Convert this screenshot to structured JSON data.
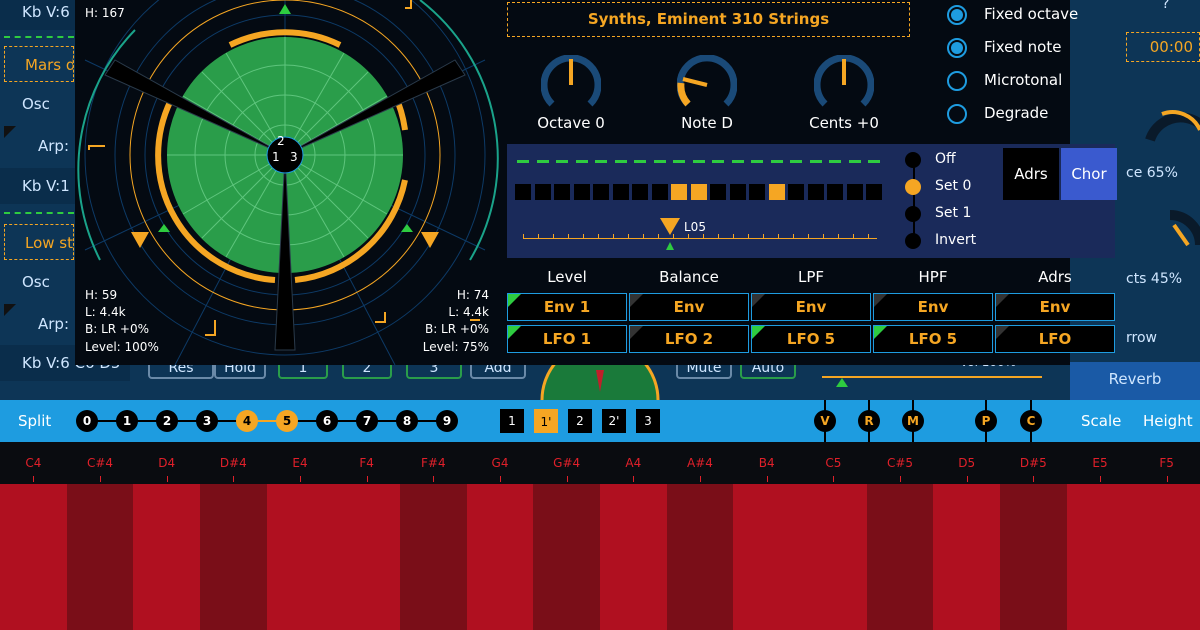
{
  "background": {
    "left_rows": [
      "Kb V:6 C",
      "Mars d",
      "Osc",
      "Arp:",
      "Kb V:1 C",
      "Low st",
      "Osc",
      "Arp:",
      "Kb V:6 C6 D5"
    ],
    "right_texts": {
      "help": "?",
      "clock": "00:00",
      "knob1": "ce 65%",
      "knob2": "cts 45%",
      "arrow": "rrow",
      "reverb": "Reverb"
    },
    "mid_buttons": [
      "Res",
      "Hold",
      "1",
      "2",
      "3",
      "Add",
      "Mute",
      "Auto"
    ],
    "mid_vol": "Vol 100%"
  },
  "radar": {
    "top_label": "H: 167",
    "center_numbers": [
      "2",
      "1",
      "3"
    ],
    "left_stats": [
      "H: 59",
      "L: 4.4k",
      "B: LR +0%",
      "Level: 100%"
    ],
    "right_stats": [
      "H: 74",
      "L: 4.4k",
      "B: LR +0%",
      "Level: 75%"
    ]
  },
  "preset": "Synths, Eminent 310 Strings",
  "knobs": [
    {
      "label": "Octave 0",
      "value": 0.5
    },
    {
      "label": "Note D",
      "value": 0.2
    },
    {
      "label": "Cents +0",
      "value": 0.5
    }
  ],
  "options": [
    {
      "label": "Fixed octave",
      "checked": true
    },
    {
      "label": "Fixed note",
      "checked": true
    },
    {
      "label": "Microtonal",
      "checked": false
    },
    {
      "label": "Degrade",
      "checked": false
    }
  ],
  "sequencer": {
    "steps_on": [
      8,
      9,
      13
    ],
    "step_count": 19,
    "marker": "L05",
    "modes": [
      {
        "label": "Off",
        "on": false
      },
      {
        "label": "Set 0",
        "on": true
      },
      {
        "label": "Set 1",
        "on": false
      },
      {
        "label": "Invert",
        "on": false
      }
    ],
    "tabs": [
      {
        "label": "Adrs",
        "active": false
      },
      {
        "label": "Chor",
        "active": true
      }
    ]
  },
  "mod_headers": [
    "Level",
    "Balance",
    "LPF",
    "HPF",
    "Adrs"
  ],
  "mod_row1": [
    {
      "label": "Env 1",
      "corner": "green"
    },
    {
      "label": "Env",
      "corner": "grey"
    },
    {
      "label": "Env",
      "corner": "grey"
    },
    {
      "label": "Env",
      "corner": "grey"
    },
    {
      "label": "Env",
      "corner": "grey"
    }
  ],
  "mod_row2": [
    {
      "label": "LFO 1",
      "corner": "green"
    },
    {
      "label": "LFO 2",
      "corner": "grey"
    },
    {
      "label": "LFO 5",
      "corner": "green"
    },
    {
      "label": "LFO 5",
      "corner": "green"
    },
    {
      "label": "LFO",
      "corner": "grey"
    }
  ],
  "split_bar": {
    "split_label": "Split",
    "numbers": [
      "0",
      "1",
      "2",
      "3",
      "4",
      "5",
      "6",
      "7",
      "8",
      "9"
    ],
    "active_numbers": [
      "4",
      "5"
    ],
    "boxes": [
      "1",
      "1'",
      "2",
      "2'",
      "3"
    ],
    "active_box": "1'",
    "pins": [
      "V",
      "R",
      "M",
      "P",
      "C"
    ],
    "scale_label": "Scale",
    "height_label": "Height"
  },
  "keyboard": {
    "labels": [
      "C4",
      "C#4",
      "D4",
      "D#4",
      "E4",
      "F4",
      "F#4",
      "G4",
      "G#4",
      "A4",
      "A#4",
      "B4",
      "C5",
      "C#5",
      "D5",
      "D#5",
      "E5",
      "F5"
    ],
    "colors": {
      "natural": "#b01020",
      "sharp": "#7a0e18"
    }
  },
  "colors": {
    "accent": "#f5a623",
    "blue": "#1e9ce0",
    "green": "#2ecc40"
  }
}
